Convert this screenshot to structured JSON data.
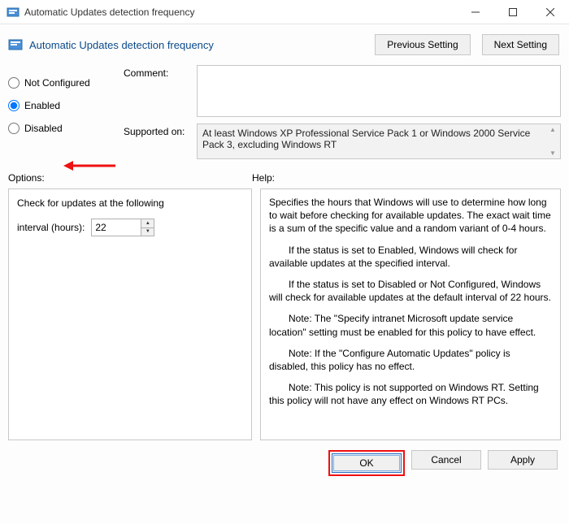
{
  "window": {
    "title": "Automatic Updates detection frequency"
  },
  "header": {
    "title": "Automatic Updates detection frequency",
    "previous_btn": "Previous Setting",
    "next_btn": "Next Setting"
  },
  "radios": {
    "not_configured": "Not Configured",
    "enabled": "Enabled",
    "disabled": "Disabled",
    "selected": "enabled"
  },
  "labels": {
    "comment": "Comment:",
    "supported_on": "Supported on:",
    "options": "Options:",
    "help": "Help:"
  },
  "supported_text": "At least Windows XP Professional Service Pack 1 or Windows 2000 Service Pack 3, excluding Windows RT",
  "options": {
    "check_label": "Check for updates at the following",
    "interval_label": "interval (hours):",
    "interval_value": "22"
  },
  "help": {
    "p1": "Specifies the hours that Windows will use to determine how long to wait before checking for available updates. The exact wait time is a sum of the specific value and a random variant of 0-4 hours.",
    "p2": "If the status is set to Enabled, Windows will check for available updates at the specified interval.",
    "p3": "If the status is set to Disabled or Not Configured, Windows will check for available updates at the default interval of 22 hours.",
    "p4": "Note: The \"Specify intranet Microsoft update service location\" setting must be enabled for this policy to have effect.",
    "p5": "Note: If the \"Configure Automatic Updates\" policy is disabled, this policy has no effect.",
    "p6": "Note: This policy is not supported on Windows RT. Setting this policy will not have any effect on Windows RT PCs."
  },
  "footer": {
    "ok": "OK",
    "cancel": "Cancel",
    "apply": "Apply"
  }
}
